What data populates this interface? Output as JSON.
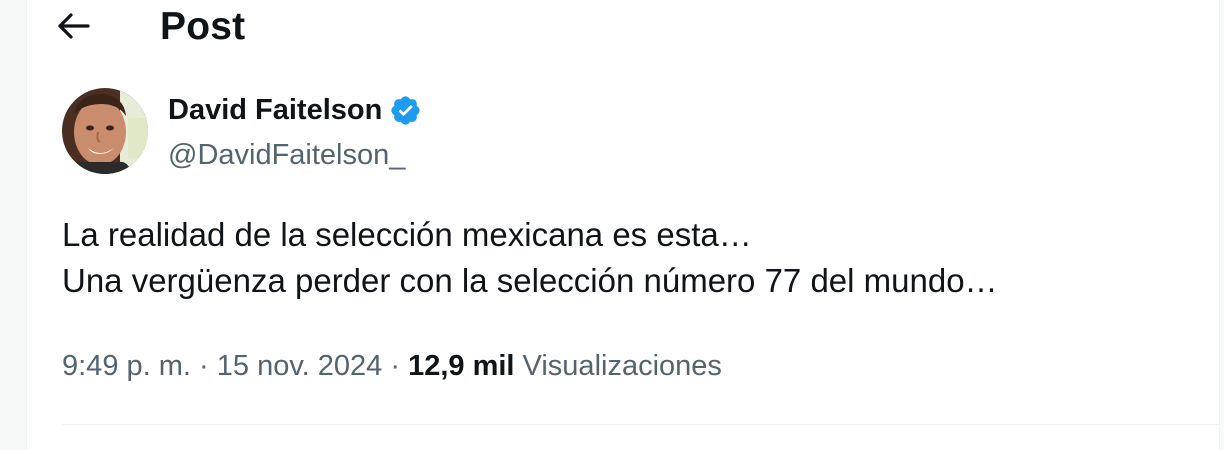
{
  "header": {
    "title": "Post",
    "back_icon": "arrow-left-icon"
  },
  "author": {
    "name": "David Faitelson",
    "handle": "@DavidFaitelson_",
    "verified_icon": "verified-badge-icon",
    "avatar_icon": "user-avatar"
  },
  "tweet": {
    "lines": [
      "La realidad de la selección mexicana es esta…",
      "Una vergüenza perder con la selección número 77 del mundo…"
    ],
    "time": "9:49 p. m.",
    "separator": " · ",
    "date": "15 nov. 2024",
    "views_count": "12,9 mil",
    "views_label": "Visualizaciones"
  },
  "colors": {
    "text_primary": "#0f1419",
    "text_secondary": "#536471",
    "verified_blue": "#1d9bf0",
    "divider": "#eff3f4"
  }
}
